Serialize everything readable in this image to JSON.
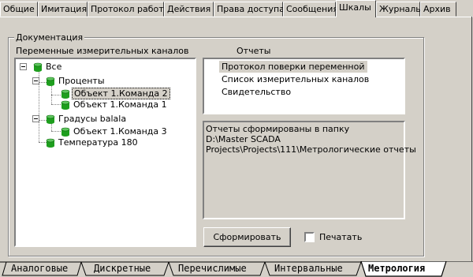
{
  "top_tabs": [
    "Общие",
    "Имитация",
    "Протокол работы",
    "Действия",
    "Права доступа",
    "Сообщения",
    "Шкалы",
    "Журналы",
    "Архив"
  ],
  "active_top_tab": "Шкалы",
  "group": {
    "title": "Документация",
    "channels_label": "Переменные измерительных каналов",
    "reports_label": "Отчеты"
  },
  "tree": {
    "root": "Все",
    "nodes": {
      "percents": "Проценты",
      "obj2": "Объект 1.Команда 2",
      "obj1": "Объект 1.Команда 1",
      "degrees": "Градусы balala",
      "obj3": "Объект 1.Команда 3",
      "temp": "Температура 180"
    }
  },
  "reports": [
    "Протокол поверки переменной",
    "Список измерительных каналов",
    "Свидетельство"
  ],
  "info": {
    "line1": "Отчеты сформированы в папку",
    "line2": "D:\\Master SCADA",
    "line3": "Projects\\Projects\\111\\Метрологические отчеты"
  },
  "actions": {
    "generate_label": "Сформировать",
    "print_label": "Печатать",
    "print_checked": false
  },
  "bottom_tabs": [
    "Аналоговые",
    "Дискретные",
    "Перечислимые",
    "Интервальные",
    "Метрология"
  ],
  "active_bottom_tab": "Метрология",
  "colors": {
    "node_icon": "#1e9e1e",
    "face": "#d4d0c8"
  }
}
